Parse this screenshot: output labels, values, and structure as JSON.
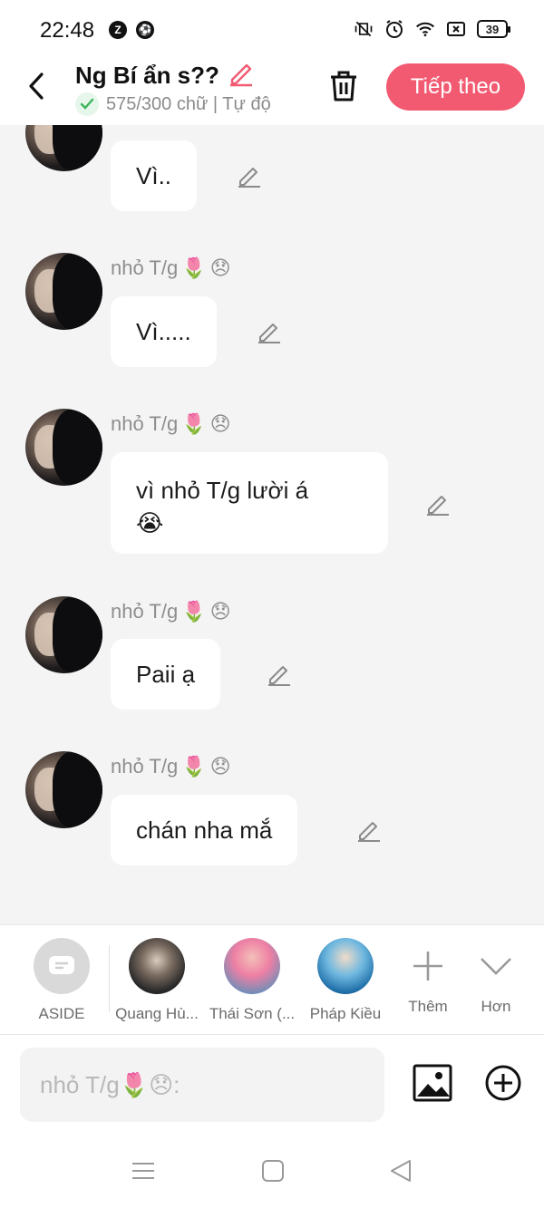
{
  "status_bar": {
    "time": "22:48",
    "battery": "39"
  },
  "header": {
    "title": "Ng Bí ẩn s??",
    "subtitle": "575/300 chữ | Tự độ",
    "next_label": "Tiếp theo"
  },
  "messages": [
    {
      "sender": "",
      "text": "Vì.."
    },
    {
      "sender": "nhỏ T/g",
      "text": "Vì....."
    },
    {
      "sender": "nhỏ T/g",
      "text": "vì nhỏ T/g lười á",
      "emoji": "😭"
    },
    {
      "sender": "nhỏ T/g",
      "text": "Paii ạ"
    },
    {
      "sender": "nhỏ T/g",
      "text": "chán nha mắ"
    }
  ],
  "sender_emojis": [
    "🌷",
    "😞"
  ],
  "characters": [
    {
      "name": "ASIDE"
    },
    {
      "name": "Quang Hù..."
    },
    {
      "name": "Thái Sơn (..."
    },
    {
      "name": "Pháp Kiều"
    },
    {
      "name": "Thêm"
    },
    {
      "name": "Hơn"
    }
  ],
  "input": {
    "placeholder": "nhỏ T/g🌷😞:"
  },
  "colors": {
    "accent": "#f25a72",
    "check": "#3bb45c",
    "background": "#f4f4f4"
  }
}
